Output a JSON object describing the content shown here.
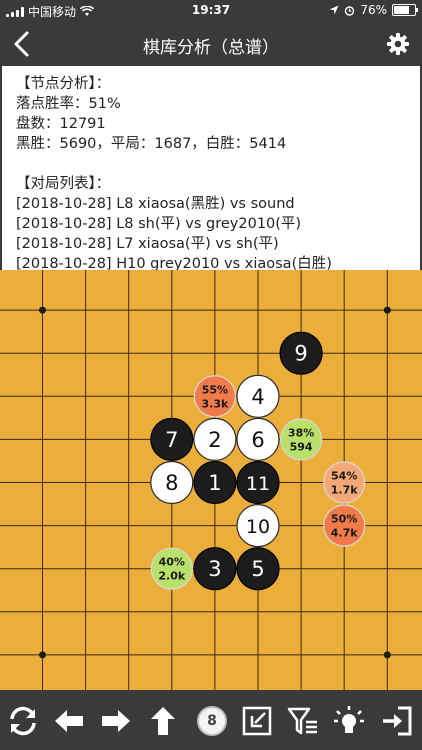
{
  "status_bar": {
    "carrier": "中国移动",
    "time": "19:37",
    "battery": "76%",
    "battery_level": 0.76
  },
  "nav": {
    "title": "棋库分析（总谱）",
    "back_icon": "chevron-left-icon",
    "settings_icon": "gear-icon"
  },
  "analysis": {
    "node_heading": "【节点分析】：",
    "win_rate": "落点胜率：51%",
    "games": "盘数：12791",
    "results": "黑胜：5690，平局：1687，白胜：5414",
    "list_heading": "【对局列表】：",
    "games_list": [
      "[2018-10-28] L8 xiaosa(黑胜) vs sound",
      "[2018-10-28] L8 sh(平) vs grey2010(平)",
      "[2018-10-28] L7 xiaosa(平) vs sh(平)",
      "[2018-10-28] H10 grey2010 vs xiaosa(白胜)"
    ]
  },
  "board": {
    "board_color": "#ebae3b",
    "stones": [
      {
        "label": "1",
        "color": "black",
        "col": 5,
        "row": 5
      },
      {
        "label": "2",
        "color": "white",
        "col": 5,
        "row": 4
      },
      {
        "label": "3",
        "color": "black",
        "col": 5,
        "row": 7
      },
      {
        "label": "4",
        "color": "white",
        "col": 6,
        "row": 3
      },
      {
        "label": "5",
        "color": "black",
        "col": 6,
        "row": 7
      },
      {
        "label": "6",
        "color": "white",
        "col": 6,
        "row": 4
      },
      {
        "label": "7",
        "color": "black",
        "col": 4,
        "row": 4
      },
      {
        "label": "8",
        "color": "white",
        "col": 4,
        "row": 5
      },
      {
        "label": "9",
        "color": "black",
        "col": 7,
        "row": 2
      },
      {
        "label": "10",
        "color": "white",
        "col": 6,
        "row": 6
      },
      {
        "label": "11",
        "color": "black",
        "col": 6,
        "row": 5
      }
    ],
    "candidates": [
      {
        "pct": "55%",
        "count": "3.3k",
        "color": "#f07a4a",
        "col": 5,
        "row": 3
      },
      {
        "pct": "38%",
        "count": "594",
        "color": "#b8e06a",
        "col": 7,
        "row": 4
      },
      {
        "pct": "54%",
        "count": "1.7k",
        "color": "#f3a87a",
        "col": 8,
        "row": 5
      },
      {
        "pct": "50%",
        "count": "4.7k",
        "color": "#f07a4a",
        "col": 8,
        "row": 6
      },
      {
        "pct": "40%",
        "count": "2.0k",
        "color": "#b8e06a",
        "col": 4,
        "row": 7
      }
    ]
  },
  "toolbar": {
    "move_number": "8",
    "icons": [
      "refresh-icon",
      "arrow-left-icon",
      "arrow-right-icon",
      "arrow-up-icon",
      "move-number-badge",
      "collapse-icon",
      "filter-list-icon",
      "lightbulb-icon",
      "exit-icon"
    ]
  }
}
